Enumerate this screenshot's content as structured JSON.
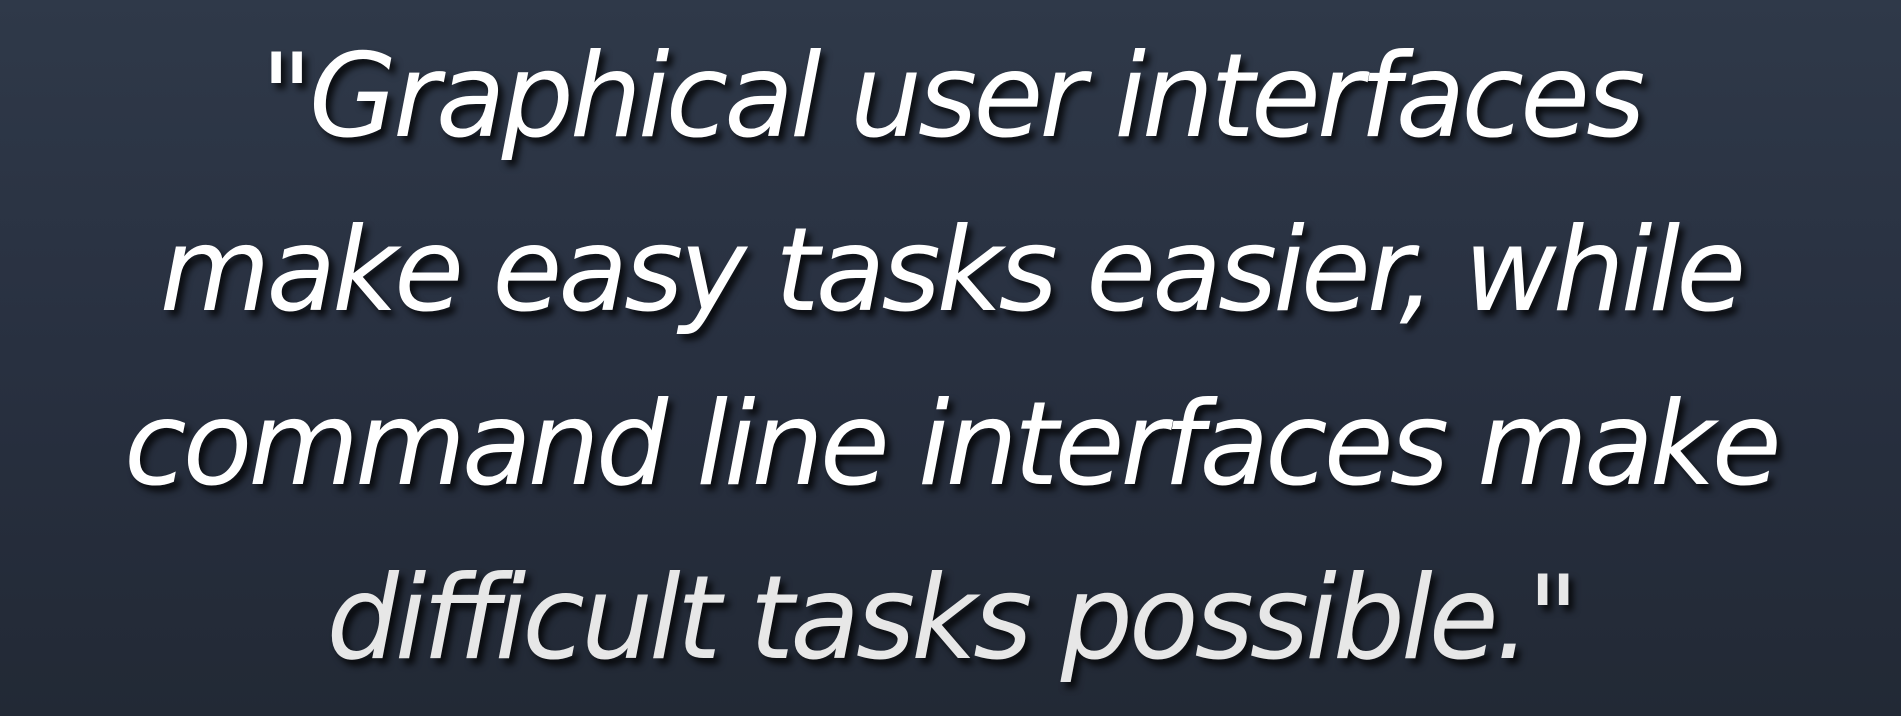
{
  "quote": {
    "lines": [
      "\"Graphical user interfaces",
      "make easy tasks easier, while",
      "command line interfaces make",
      "difficult tasks possible.\""
    ]
  },
  "colors": {
    "background": "#2a3242",
    "text": "#ffffff"
  }
}
